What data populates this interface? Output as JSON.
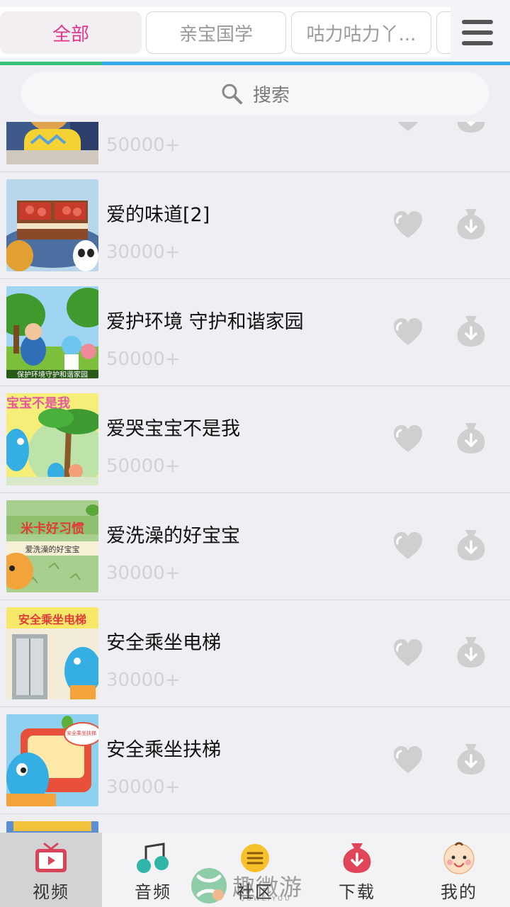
{
  "tabs": [
    {
      "label": "全部",
      "active": true
    },
    {
      "label": "亲宝国学",
      "active": false
    },
    {
      "label": "咕力咕力丫...",
      "active": false
    },
    {
      "label": "",
      "active": false
    }
  ],
  "search": {
    "placeholder": "搜索"
  },
  "videos": [
    {
      "title": "",
      "count": "50000+"
    },
    {
      "title": "爱的味道[2]",
      "count": "30000+"
    },
    {
      "title": "爱护环境 守护和谐家园",
      "count": "50000+"
    },
    {
      "title": "爱哭宝宝不是我",
      "count": "50000+"
    },
    {
      "title": "爱洗澡的好宝宝",
      "count": "30000+"
    },
    {
      "title": "安全乘坐电梯",
      "count": "30000+"
    },
    {
      "title": "安全乘坐扶梯",
      "count": "30000+"
    }
  ],
  "thumb_text": {
    "row2": "保护环境守护和谐家园",
    "row3": "宝宝不是我",
    "row4_top": "米卡好习惯",
    "row4_sub": "爱洗澡的好宝宝",
    "row5": "安全乘坐电梯",
    "row6": "安全乘坐扶梯"
  },
  "bottom_nav": [
    {
      "label": "视频",
      "icon": "video-icon",
      "active": true
    },
    {
      "label": "音频",
      "icon": "music-note-icon",
      "active": false
    },
    {
      "label": "社区",
      "icon": "community-icon",
      "active": false
    },
    {
      "label": "下载",
      "icon": "download-icon",
      "active": false
    },
    {
      "label": "我的",
      "icon": "baby-face-icon",
      "active": false
    }
  ],
  "watermark": {
    "text": "趣微游",
    "sub": "QUWEIYOU"
  },
  "colors": {
    "accent_pink": "#e4378b",
    "progress_green": "#35c27a",
    "progress_blue": "#35a8f0",
    "icon_grey": "#cfcfcf",
    "count_grey": "#d2d2d2"
  }
}
